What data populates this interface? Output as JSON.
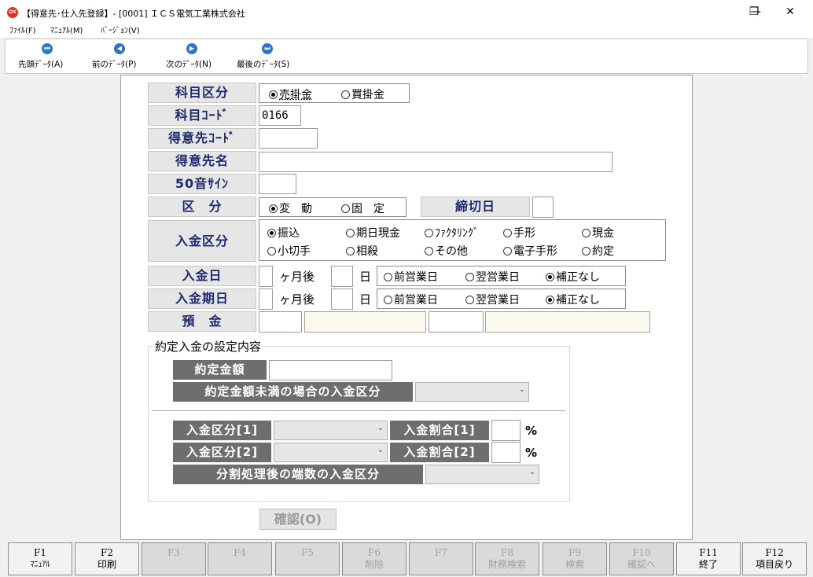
{
  "window": {
    "title": "【得意先･仕入先登録】- [0001] ＩＣＳ電気工業株式会社",
    "app_icon_text": "OX",
    "min_glyph": "—",
    "max_glyph": "❐",
    "close_glyph": "✕"
  },
  "menu": [
    {
      "label": "ﾌｧｲﾙ(F)"
    },
    {
      "label": "ﾏﾆｭｱﾙ(M)"
    },
    {
      "label": "ﾊﾞｰｼﾞｮﾝ(V)"
    }
  ],
  "toolbar": [
    {
      "label": "先頭ﾃﾞｰﾀ(A)",
      "icon": "first-record-icon",
      "glyph": "⏮"
    },
    {
      "label": "前のﾃﾞｰﾀ(P)",
      "icon": "prev-record-icon",
      "glyph": "◀"
    },
    {
      "label": "次のﾃﾞｰﾀ(N)",
      "icon": "next-record-icon",
      "glyph": "▶"
    },
    {
      "label": "最後のﾃﾞｰﾀ(S)",
      "icon": "last-record-icon",
      "glyph": "⏭"
    }
  ],
  "form": {
    "kamoku_kubun": {
      "label": "科目区分",
      "options": [
        "売掛金",
        "買掛金"
      ],
      "selected": 0
    },
    "kamoku_code": {
      "label": "科目ｺｰﾄﾞ",
      "value": "0166"
    },
    "tokuisaki_code": {
      "label": "得意先ｺｰﾄﾞ",
      "value": ""
    },
    "tokuisaki_name": {
      "label": "得意先名",
      "value": ""
    },
    "index_50": {
      "label": "50音ｻｲﾝ",
      "value": ""
    },
    "kubun": {
      "label": "区　分",
      "options": [
        "変　動",
        "固　定"
      ],
      "selected": 0
    },
    "shimebi": {
      "label": "締切日",
      "value": ""
    },
    "nyukin_kubun": {
      "label": "入金区分",
      "options": [
        "振込",
        "期日現金",
        "ﾌｧｸﾀﾘﾝｸﾞ",
        "手形",
        "現金",
        "小切手",
        "相殺",
        "その他",
        "電子手形",
        "約定"
      ],
      "selected": 0
    },
    "nyukin_bi": {
      "label": "入金日",
      "month_unit": "ヶ月後",
      "day_unit": "日",
      "options": [
        "前営業日",
        "翌営業日",
        "補正なし"
      ],
      "selected": 2
    },
    "nyukin_kijitsu": {
      "label": "入金期日",
      "month_unit": "ヶ月後",
      "day_unit": "日",
      "options": [
        "前営業日",
        "翌営業日",
        "補正なし"
      ],
      "selected": 2
    },
    "yokin": {
      "label": "預　金"
    }
  },
  "yakujo": {
    "group_title": "約定入金の設定内容",
    "amount_label": "約定金額",
    "under_label": "約定金額未満の場合の入金区分",
    "kubun1_label": "入金区分[1]",
    "ratio1_label": "入金割合[1]",
    "kubun2_label": "入金区分[2]",
    "ratio2_label": "入金割合[2]",
    "percent": "%",
    "remainder_label": "分割処理後の端数の入金区分",
    "confirm_label": "確認(O)"
  },
  "fkeys": [
    {
      "key": "F1",
      "label": "ﾏﾆｭｱﾙ",
      "enabled": true
    },
    {
      "key": "F2",
      "label": "印刷",
      "enabled": true
    },
    {
      "key": "F3",
      "label": "",
      "enabled": false
    },
    {
      "key": "F4",
      "label": "",
      "enabled": false
    },
    {
      "key": "F5",
      "label": "",
      "enabled": false
    },
    {
      "key": "F6",
      "label": "削除",
      "enabled": false
    },
    {
      "key": "F7",
      "label": "",
      "enabled": false
    },
    {
      "key": "F8",
      "label": "財務検索",
      "enabled": false
    },
    {
      "key": "F9",
      "label": "検索",
      "enabled": false
    },
    {
      "key": "F10",
      "label": "確認へ",
      "enabled": false
    },
    {
      "key": "F11",
      "label": "終了",
      "enabled": true
    },
    {
      "key": "F12",
      "label": "項目戻り",
      "enabled": true
    }
  ]
}
